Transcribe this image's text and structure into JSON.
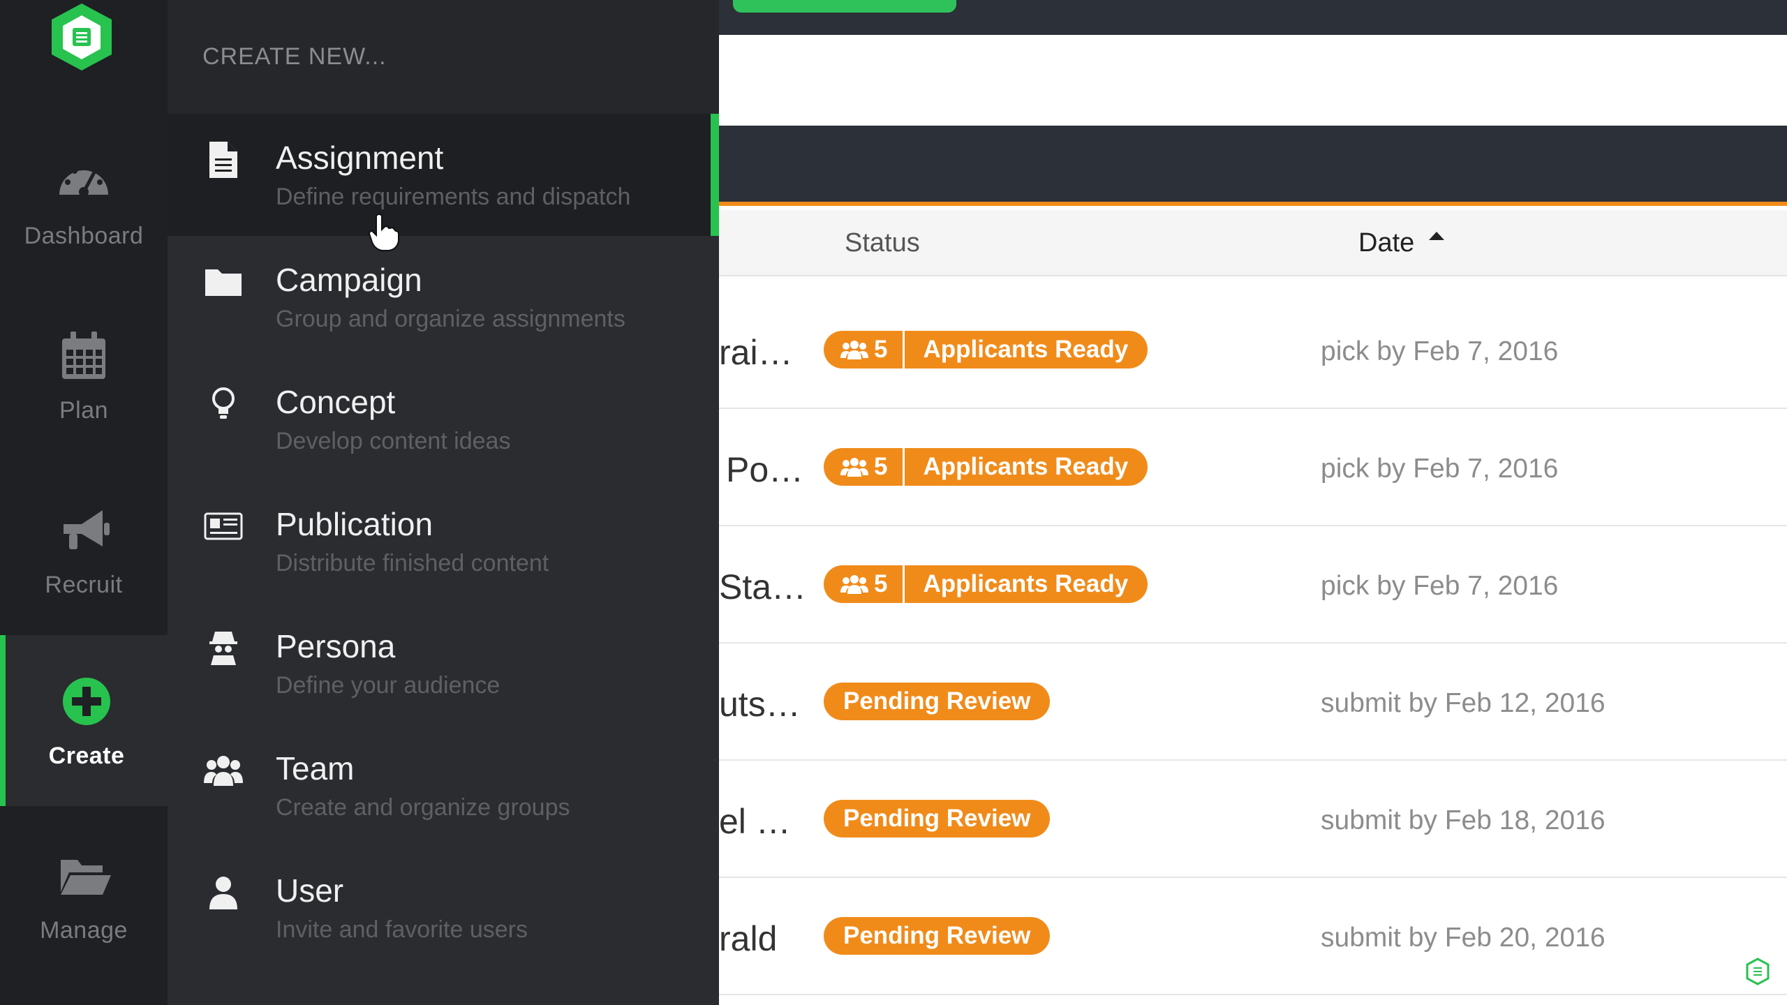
{
  "rail": {
    "items": [
      {
        "label": "Dashboard",
        "icon": "gauge-icon"
      },
      {
        "label": "Plan",
        "icon": "calendar-icon"
      },
      {
        "label": "Recruit",
        "icon": "megaphone-icon"
      },
      {
        "label": "Create",
        "icon": "plus-circle-icon",
        "active": true
      },
      {
        "label": "Manage",
        "icon": "folder-open-icon"
      }
    ]
  },
  "panel": {
    "header": "CREATE NEW...",
    "items": [
      {
        "title": "Assignment",
        "desc": "Define requirements and dispatch",
        "icon": "document-icon"
      },
      {
        "title": "Campaign",
        "desc": "Group and organize assignments",
        "icon": "folder-icon"
      },
      {
        "title": "Concept",
        "desc": "Develop content ideas",
        "icon": "lightbulb-icon"
      },
      {
        "title": "Publication",
        "desc": "Distribute finished content",
        "icon": "newspaper-icon"
      },
      {
        "title": "Persona",
        "desc": "Define your audience",
        "icon": "spy-icon"
      },
      {
        "title": "Team",
        "desc": "Create and organize groups",
        "icon": "users-icon"
      },
      {
        "title": "User",
        "desc": "Invite and favorite users",
        "icon": "user-icon"
      }
    ]
  },
  "table": {
    "headers": {
      "status": "Status",
      "date": "Date"
    },
    "rows": [
      {
        "name": "rai…",
        "count": "5",
        "status": "Applicants Ready",
        "date": "pick by Feb 7, 2016"
      },
      {
        "name": "Po…",
        "count": "5",
        "status": "Applicants Ready",
        "date": "pick by Feb 7, 2016"
      },
      {
        "name": "Sta…",
        "count": "5",
        "status": "Applicants Ready",
        "date": "pick by Feb 7, 2016"
      },
      {
        "name": "uts…",
        "count": null,
        "status": "Pending Review",
        "date": "submit by Feb 12, 2016"
      },
      {
        "name": "el …",
        "count": null,
        "status": "Pending Review",
        "date": "submit by Feb 18, 2016"
      },
      {
        "name": "rald",
        "count": null,
        "status": "Pending Review",
        "date": "submit by Feb 20, 2016"
      }
    ]
  },
  "colors": {
    "accent_green": "#28c24f",
    "badge_orange": "#f08b1a",
    "nav_dark": "#1e2023"
  }
}
